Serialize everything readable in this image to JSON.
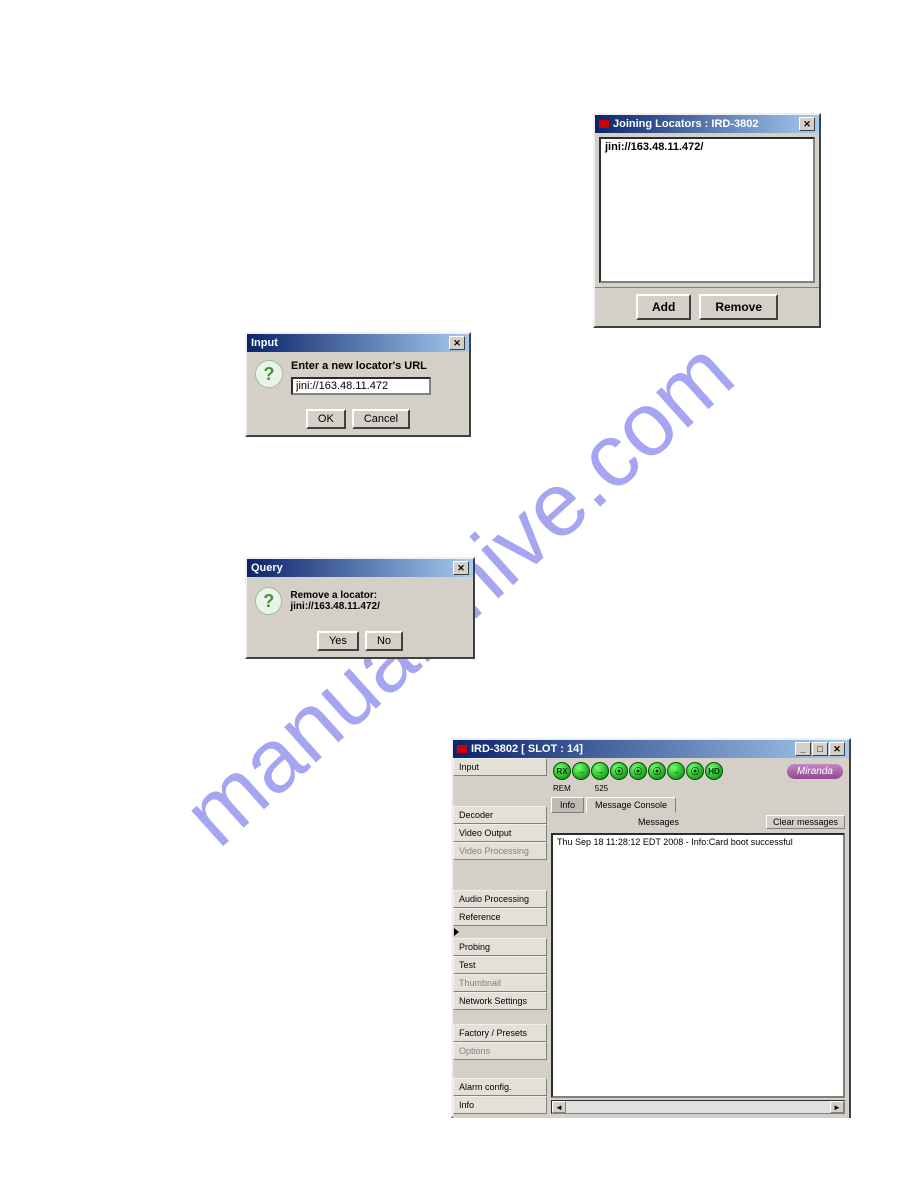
{
  "watermark": "manualshive.com",
  "joining": {
    "title": "Joining Locators : IRD-3802",
    "entry": "jini://163.48.11.472/",
    "add": "Add",
    "remove": "Remove"
  },
  "input": {
    "title": "Input",
    "prompt": "Enter a new locator's URL",
    "value": "jini://163.48.11.472",
    "ok": "OK",
    "cancel": "Cancel"
  },
  "query": {
    "title": "Query",
    "message": "Remove a locator: jini://163.48.11.472/",
    "yes": "Yes",
    "no": "No"
  },
  "main": {
    "title": "IRD-3802 [ SLOT : 14]",
    "brand": "Miranda",
    "signals": {
      "a": "REM",
      "b": "525"
    },
    "icons": [
      "RX",
      "→",
      "→",
      "⦿",
      "⦿",
      "⦿",
      "→",
      "⦿",
      "HD"
    ],
    "sidebar": [
      {
        "label": "Input",
        "disabled": false
      },
      {
        "label": "Decoder",
        "disabled": false
      },
      {
        "label": "Video Output",
        "disabled": false
      },
      {
        "label": "Video Processing",
        "disabled": true
      },
      {
        "label": "Audio Processing",
        "disabled": false
      },
      {
        "label": "Reference",
        "disabled": false
      },
      {
        "label": "Probing",
        "disabled": false
      },
      {
        "label": "Test",
        "disabled": false
      },
      {
        "label": "Thumbnail",
        "disabled": true
      },
      {
        "label": "Network Settings",
        "disabled": false
      },
      {
        "label": "Factory / Presets",
        "disabled": false
      },
      {
        "label": "Options",
        "disabled": true
      },
      {
        "label": "Alarm config.",
        "disabled": false
      },
      {
        "label": "Info",
        "disabled": false
      }
    ],
    "tabs": {
      "info": "Info",
      "console": "Message Console"
    },
    "messages_header": "Messages",
    "clear": "Clear messages",
    "log_entry": "Thu Sep 18 11:28:12 EDT 2008 - Info:Card boot successful"
  }
}
